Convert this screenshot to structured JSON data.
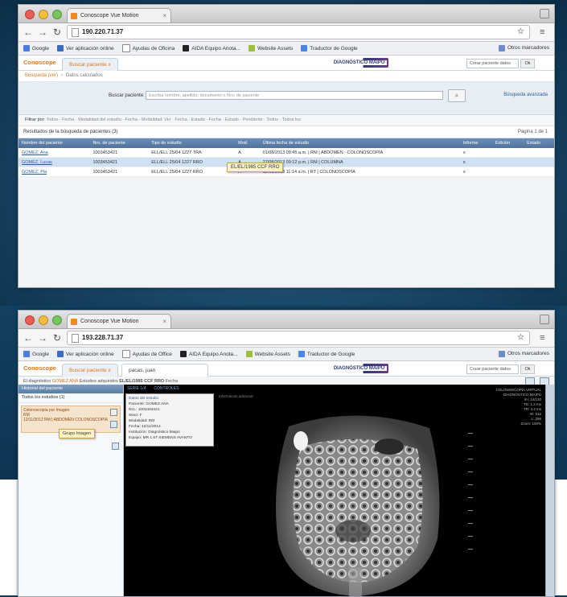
{
  "browser": {
    "tab_title": "Conoscope Vue Motion",
    "url1": "190.220.71.37",
    "url2": "193.228.71.37",
    "bookmarks1": [
      "Google",
      "Ver aplicación online",
      "Ayudas de Oficina",
      "AIDA Equipo Anota...",
      "Website Assets",
      "Traductor de Google"
    ],
    "bookmarks2": [
      "Google",
      "Ver aplicación online",
      "Ayudas de Office",
      "AIDA Equipo Anota...",
      "Website Assets",
      "Traductor de Google"
    ],
    "bookmarks_right": "Otros marcadores"
  },
  "app": {
    "brand": "Conoscope",
    "tab_search": "Buscar paciente",
    "tab_search_close": "x",
    "tab_study": "pacas, juan",
    "logo": "DIAGNÓSTICO MAIPÚ",
    "user_placeholder": "Crear paciente datos",
    "user_button": "Ok"
  },
  "screen1": {
    "crumb_home": "Búsqueda (ver)",
    "crumb_current": "Datos calculados",
    "search_label": "Buscar paciente:",
    "search_placeholder": "Escriba nombre, apellido, documento o Nro. de paciente",
    "advanced": "Búsqueda avanzada",
    "filters_label": "Filtrar por:",
    "filters": "Todos · Fecha · Modalidad del estudio · Fecha · Modalidad: Ver · Fecha · Estado · Fecha · Estado · Pendiente · Todos · Todos los",
    "grid_caption": "Resultados de la búsqueda de pacientes (3)",
    "pager": "Página 1 de 1",
    "columns": [
      "Nombre del paciente",
      "Nro. de paciente",
      "Tipo de estudio",
      "Mod.",
      "Última fecha de estudio",
      "",
      "Informe",
      "Edición",
      "Estado"
    ],
    "rows": [
      [
        "GOMEZ, Ana",
        "1003453421",
        "ELL/ELL 25/04 1227 TRA",
        "A",
        "01/08/2013 09:45 a.m. | RM | ABDOMEN - COLONOSCOPÍA",
        "",
        "x",
        "",
        ""
      ],
      [
        "GOMEZ, Lucas",
        "1003453421",
        "ELL/ELL 25/04 1227 RRO",
        "A",
        "27/08/2013 09:12 p.m. | RM | COLUMNA",
        "",
        "x",
        "",
        ""
      ],
      [
        "GOMEZ, Pia",
        "1003453421",
        "ELL/ELL 25/04 1227 RRO",
        "A",
        "12/08/2013 11:14 a.m. | RT | COLONOSCOPÍA",
        "",
        "x",
        "",
        ""
      ]
    ],
    "tooltip": "EL/EL/1985 CCF RRO"
  },
  "screen2": {
    "info_prefix": "El diagnóstico",
    "info_highlight": "GOMEZ ANA",
    "info_rest": "Estudios adquiridos",
    "info_code": "EL/EL/1985 CCF RRO",
    "info_tail": "Fecha",
    "left_head": "Historial del paciente",
    "left_sub": "Todos los estudios (1)",
    "study_item_title": "Colonoscopía por Imagen",
    "study_item_line2": "RM",
    "study_item_line3": "12/11/2012 RM | ABDOMEN COLONOSCOPÍA",
    "study_tooltip": "Grupo Imagen",
    "series_tabs": [
      "SERIE 1/4",
      "CONTROLES"
    ],
    "popup_title": "Datos del estudio",
    "popup_lines": [
      "Paciente: GOMEZ ANA",
      "Nro.: 1003453421",
      "Sexo: F",
      "Modalidad: RM",
      "Fecha: 12/11/2012",
      "Institución: Diagnóstico Maipú",
      "Equipo: MR 1.5T SIEMENS AVANTO"
    ],
    "popup2": "Información adicional",
    "overlay": [
      "COLONOSCOPÍA VIRTUAL",
      "DIAGNÓSTICO MAIPÚ",
      "Im: 14/120",
      "TE: 1.2 ms",
      "TR: 3.4 ms",
      "W: 512",
      "L: 256",
      "Zoom: 100%"
    ]
  }
}
